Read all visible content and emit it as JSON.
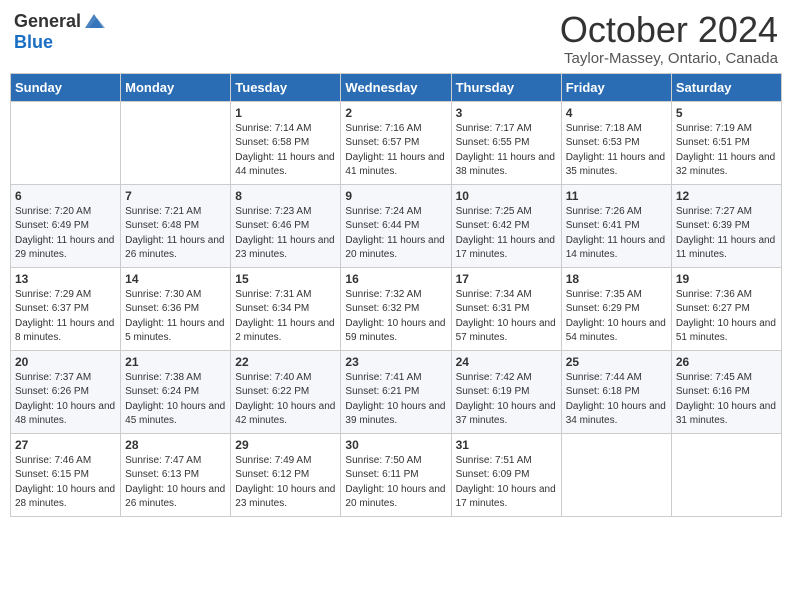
{
  "header": {
    "logo_general": "General",
    "logo_blue": "Blue",
    "month": "October 2024",
    "location": "Taylor-Massey, Ontario, Canada"
  },
  "days_of_week": [
    "Sunday",
    "Monday",
    "Tuesday",
    "Wednesday",
    "Thursday",
    "Friday",
    "Saturday"
  ],
  "weeks": [
    [
      {
        "day": null,
        "detail": ""
      },
      {
        "day": null,
        "detail": ""
      },
      {
        "day": "1",
        "detail": "Sunrise: 7:14 AM\nSunset: 6:58 PM\nDaylight: 11 hours and 44 minutes."
      },
      {
        "day": "2",
        "detail": "Sunrise: 7:16 AM\nSunset: 6:57 PM\nDaylight: 11 hours and 41 minutes."
      },
      {
        "day": "3",
        "detail": "Sunrise: 7:17 AM\nSunset: 6:55 PM\nDaylight: 11 hours and 38 minutes."
      },
      {
        "day": "4",
        "detail": "Sunrise: 7:18 AM\nSunset: 6:53 PM\nDaylight: 11 hours and 35 minutes."
      },
      {
        "day": "5",
        "detail": "Sunrise: 7:19 AM\nSunset: 6:51 PM\nDaylight: 11 hours and 32 minutes."
      }
    ],
    [
      {
        "day": "6",
        "detail": "Sunrise: 7:20 AM\nSunset: 6:49 PM\nDaylight: 11 hours and 29 minutes."
      },
      {
        "day": "7",
        "detail": "Sunrise: 7:21 AM\nSunset: 6:48 PM\nDaylight: 11 hours and 26 minutes."
      },
      {
        "day": "8",
        "detail": "Sunrise: 7:23 AM\nSunset: 6:46 PM\nDaylight: 11 hours and 23 minutes."
      },
      {
        "day": "9",
        "detail": "Sunrise: 7:24 AM\nSunset: 6:44 PM\nDaylight: 11 hours and 20 minutes."
      },
      {
        "day": "10",
        "detail": "Sunrise: 7:25 AM\nSunset: 6:42 PM\nDaylight: 11 hours and 17 minutes."
      },
      {
        "day": "11",
        "detail": "Sunrise: 7:26 AM\nSunset: 6:41 PM\nDaylight: 11 hours and 14 minutes."
      },
      {
        "day": "12",
        "detail": "Sunrise: 7:27 AM\nSunset: 6:39 PM\nDaylight: 11 hours and 11 minutes."
      }
    ],
    [
      {
        "day": "13",
        "detail": "Sunrise: 7:29 AM\nSunset: 6:37 PM\nDaylight: 11 hours and 8 minutes."
      },
      {
        "day": "14",
        "detail": "Sunrise: 7:30 AM\nSunset: 6:36 PM\nDaylight: 11 hours and 5 minutes."
      },
      {
        "day": "15",
        "detail": "Sunrise: 7:31 AM\nSunset: 6:34 PM\nDaylight: 11 hours and 2 minutes."
      },
      {
        "day": "16",
        "detail": "Sunrise: 7:32 AM\nSunset: 6:32 PM\nDaylight: 10 hours and 59 minutes."
      },
      {
        "day": "17",
        "detail": "Sunrise: 7:34 AM\nSunset: 6:31 PM\nDaylight: 10 hours and 57 minutes."
      },
      {
        "day": "18",
        "detail": "Sunrise: 7:35 AM\nSunset: 6:29 PM\nDaylight: 10 hours and 54 minutes."
      },
      {
        "day": "19",
        "detail": "Sunrise: 7:36 AM\nSunset: 6:27 PM\nDaylight: 10 hours and 51 minutes."
      }
    ],
    [
      {
        "day": "20",
        "detail": "Sunrise: 7:37 AM\nSunset: 6:26 PM\nDaylight: 10 hours and 48 minutes."
      },
      {
        "day": "21",
        "detail": "Sunrise: 7:38 AM\nSunset: 6:24 PM\nDaylight: 10 hours and 45 minutes."
      },
      {
        "day": "22",
        "detail": "Sunrise: 7:40 AM\nSunset: 6:22 PM\nDaylight: 10 hours and 42 minutes."
      },
      {
        "day": "23",
        "detail": "Sunrise: 7:41 AM\nSunset: 6:21 PM\nDaylight: 10 hours and 39 minutes."
      },
      {
        "day": "24",
        "detail": "Sunrise: 7:42 AM\nSunset: 6:19 PM\nDaylight: 10 hours and 37 minutes."
      },
      {
        "day": "25",
        "detail": "Sunrise: 7:44 AM\nSunset: 6:18 PM\nDaylight: 10 hours and 34 minutes."
      },
      {
        "day": "26",
        "detail": "Sunrise: 7:45 AM\nSunset: 6:16 PM\nDaylight: 10 hours and 31 minutes."
      }
    ],
    [
      {
        "day": "27",
        "detail": "Sunrise: 7:46 AM\nSunset: 6:15 PM\nDaylight: 10 hours and 28 minutes."
      },
      {
        "day": "28",
        "detail": "Sunrise: 7:47 AM\nSunset: 6:13 PM\nDaylight: 10 hours and 26 minutes."
      },
      {
        "day": "29",
        "detail": "Sunrise: 7:49 AM\nSunset: 6:12 PM\nDaylight: 10 hours and 23 minutes."
      },
      {
        "day": "30",
        "detail": "Sunrise: 7:50 AM\nSunset: 6:11 PM\nDaylight: 10 hours and 20 minutes."
      },
      {
        "day": "31",
        "detail": "Sunrise: 7:51 AM\nSunset: 6:09 PM\nDaylight: 10 hours and 17 minutes."
      },
      {
        "day": null,
        "detail": ""
      },
      {
        "day": null,
        "detail": ""
      }
    ]
  ]
}
